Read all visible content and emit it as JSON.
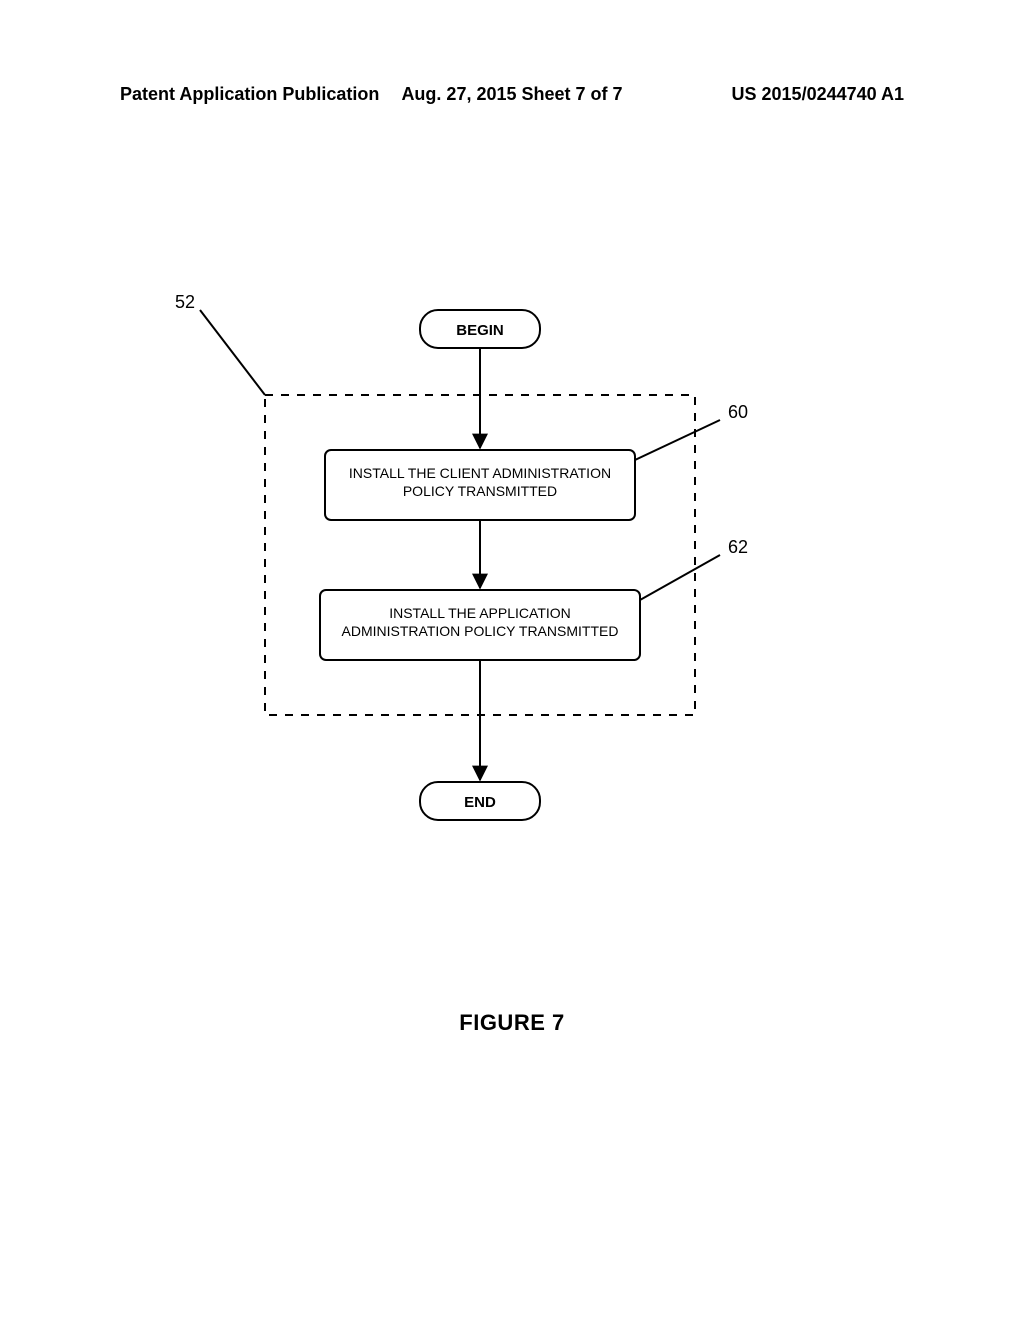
{
  "header": {
    "left": "Patent Application Publication",
    "center": "Aug. 27, 2015  Sheet 7 of 7",
    "right": "US 2015/0244740 A1"
  },
  "flow": {
    "begin": "BEGIN",
    "end": "END",
    "step60_l1": "INSTALL THE CLIENT ADMINISTRATION",
    "step60_l2": "POLICY TRANSMITTED",
    "step62_l1": "INSTALL THE APPLICATION",
    "step62_l2": "ADMINISTRATION POLICY TRANSMITTED"
  },
  "labels": {
    "ref52": "52",
    "ref60": "60",
    "ref62": "62"
  },
  "figure_caption": "FIGURE 7"
}
